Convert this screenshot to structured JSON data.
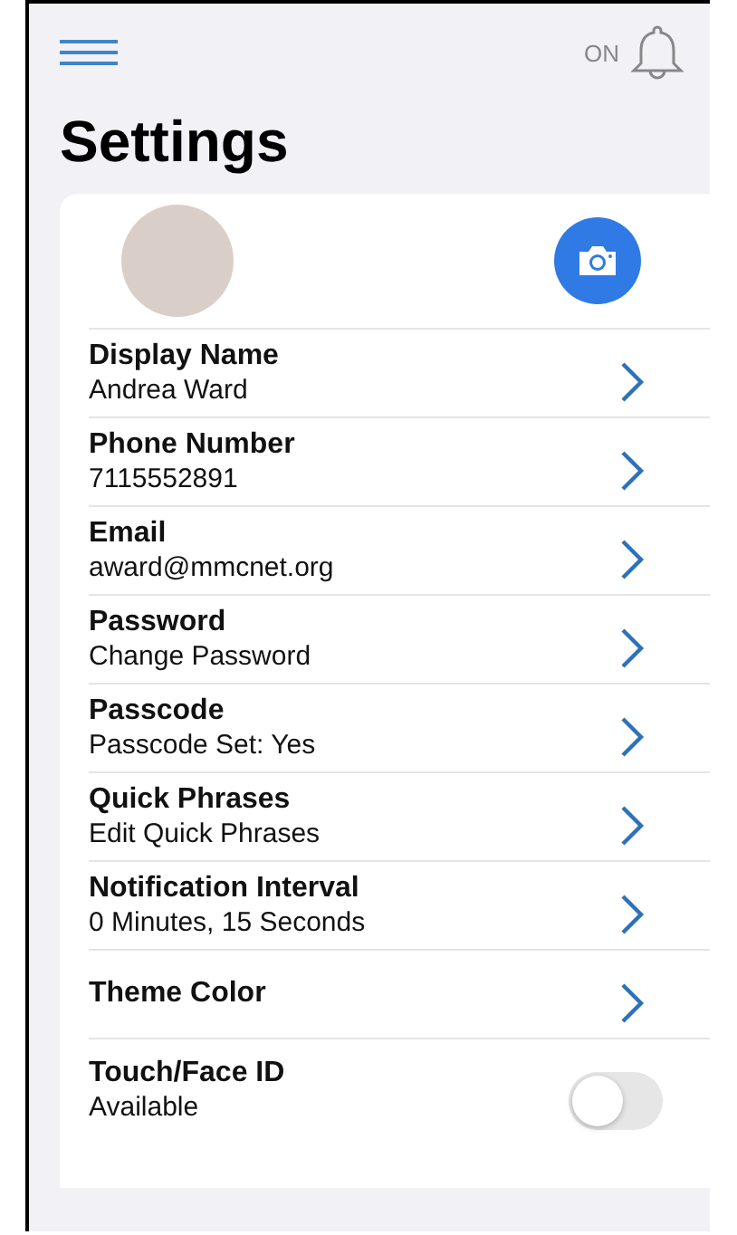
{
  "header": {
    "notification_status": "ON"
  },
  "title": "Settings",
  "items": [
    {
      "kind": "link",
      "label": "Display Name",
      "value": "Andrea Ward"
    },
    {
      "kind": "link",
      "label": "Phone Number",
      "value": "7115552891"
    },
    {
      "kind": "link",
      "label": "Email",
      "value": "award@mmcnet.org"
    },
    {
      "kind": "link",
      "label": "Password",
      "value": "Change Password"
    },
    {
      "kind": "link",
      "label": "Passcode",
      "value": "Passcode Set: Yes"
    },
    {
      "kind": "link",
      "label": "Quick Phrases",
      "value": "Edit Quick Phrases"
    },
    {
      "kind": "link",
      "label": "Notification Interval",
      "value": "0 Minutes, 15 Seconds"
    },
    {
      "kind": "link",
      "label": "Theme Color"
    },
    {
      "kind": "toggle",
      "label": "Touch/Face ID",
      "value": "Available",
      "on": false
    }
  ]
}
